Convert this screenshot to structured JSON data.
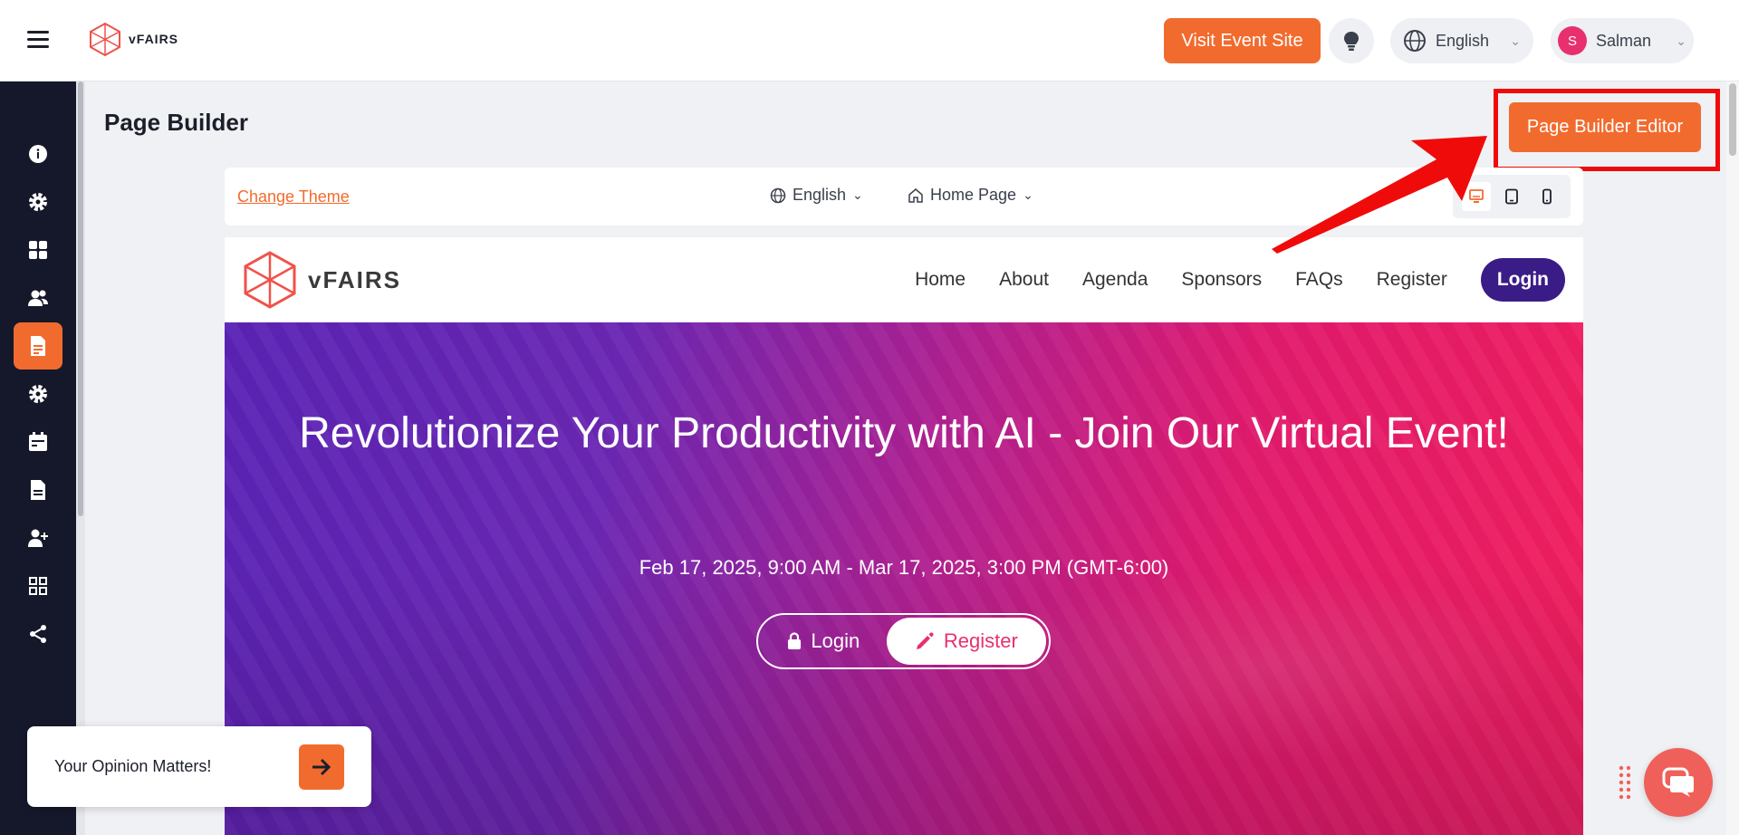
{
  "topbar": {
    "brand": "vFAIRS",
    "visit_button": "Visit Event Site",
    "language": "English",
    "user_initial": "S",
    "user_name": "Salman"
  },
  "sidebar": {
    "items": [
      {
        "icon": "info-icon",
        "active": false
      },
      {
        "icon": "gear-icon",
        "active": false
      },
      {
        "icon": "grid-icon",
        "active": false
      },
      {
        "icon": "users-icon",
        "active": false
      },
      {
        "icon": "page-icon",
        "active": true
      },
      {
        "icon": "gear-icon",
        "active": false
      },
      {
        "icon": "calendar-icon",
        "active": false
      },
      {
        "icon": "document-icon",
        "active": false
      },
      {
        "icon": "add-user-icon",
        "active": false
      },
      {
        "icon": "apps-icon",
        "active": false
      },
      {
        "icon": "share-icon",
        "active": false
      }
    ]
  },
  "main": {
    "page_title": "Page Builder",
    "editor_button": "Page Builder Editor",
    "toolbar": {
      "change_theme": "Change Theme",
      "language": "English",
      "page": "Home Page"
    }
  },
  "preview": {
    "logo_text": "vFAIRS",
    "nav": [
      "Home",
      "About",
      "Agenda",
      "Sponsors",
      "FAQs",
      "Register"
    ],
    "nav_login": "Login",
    "hero_title": "Revolutionize Your Productivity with AI - Join Our Virtual Event!",
    "hero_date": "Feb 17, 2025, 9:00 AM - Mar 17, 2025, 3:00 PM (GMT-6:00)",
    "cta_login": "Login",
    "cta_register": "Register"
  },
  "opinion": {
    "text": "Your Opinion Matters!"
  },
  "colors": {
    "accent": "#f26b2e",
    "sidebar": "#15182a",
    "highlight": "#f00b0b",
    "nav_login": "#3a1c86"
  }
}
